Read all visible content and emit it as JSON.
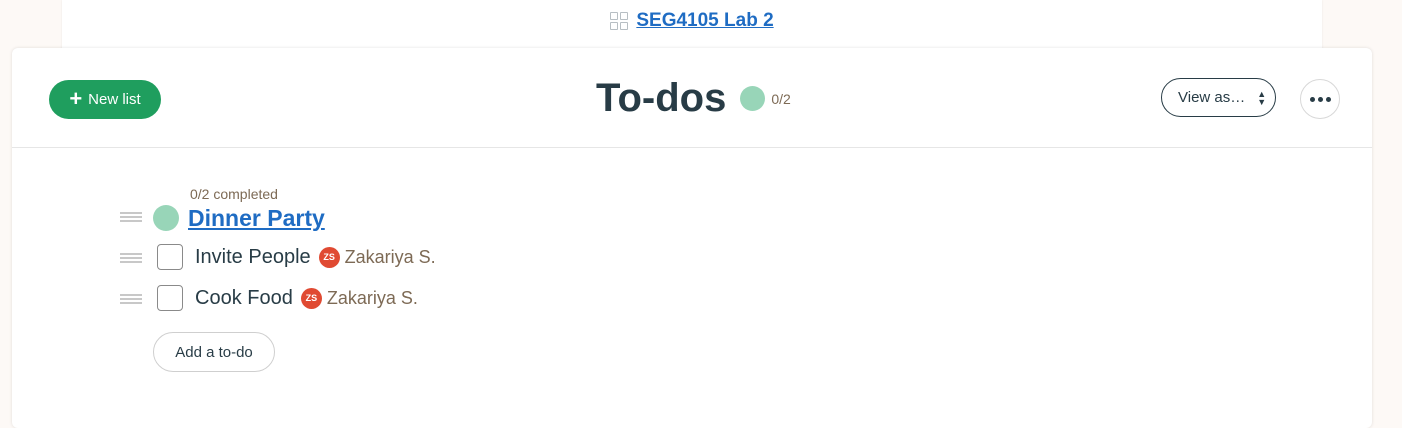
{
  "project": {
    "name": "SEG4105 Lab 2",
    "icon": "grid-icon"
  },
  "header": {
    "new_list_label": "New list",
    "title": "To-dos",
    "progress": "0/2",
    "view_as_label": "View as…",
    "more_icon": "ellipsis-icon"
  },
  "list": {
    "completed_summary": "0/2 completed",
    "title": "Dinner Party",
    "todos": [
      {
        "text": "Invite People",
        "assignee_initials": "ZS",
        "assignee": "Zakariya S.",
        "done": false
      },
      {
        "text": "Cook Food",
        "assignee_initials": "ZS",
        "assignee": "Zakariya S.",
        "done": false
      }
    ],
    "add_todo_label": "Add a to-do"
  },
  "colors": {
    "brand_green": "#1f9e5e",
    "progress_green": "#98d5b8",
    "link_blue": "#1f6cc3",
    "avatar_red": "#e04a32",
    "muted_brown": "#7d6a55"
  }
}
